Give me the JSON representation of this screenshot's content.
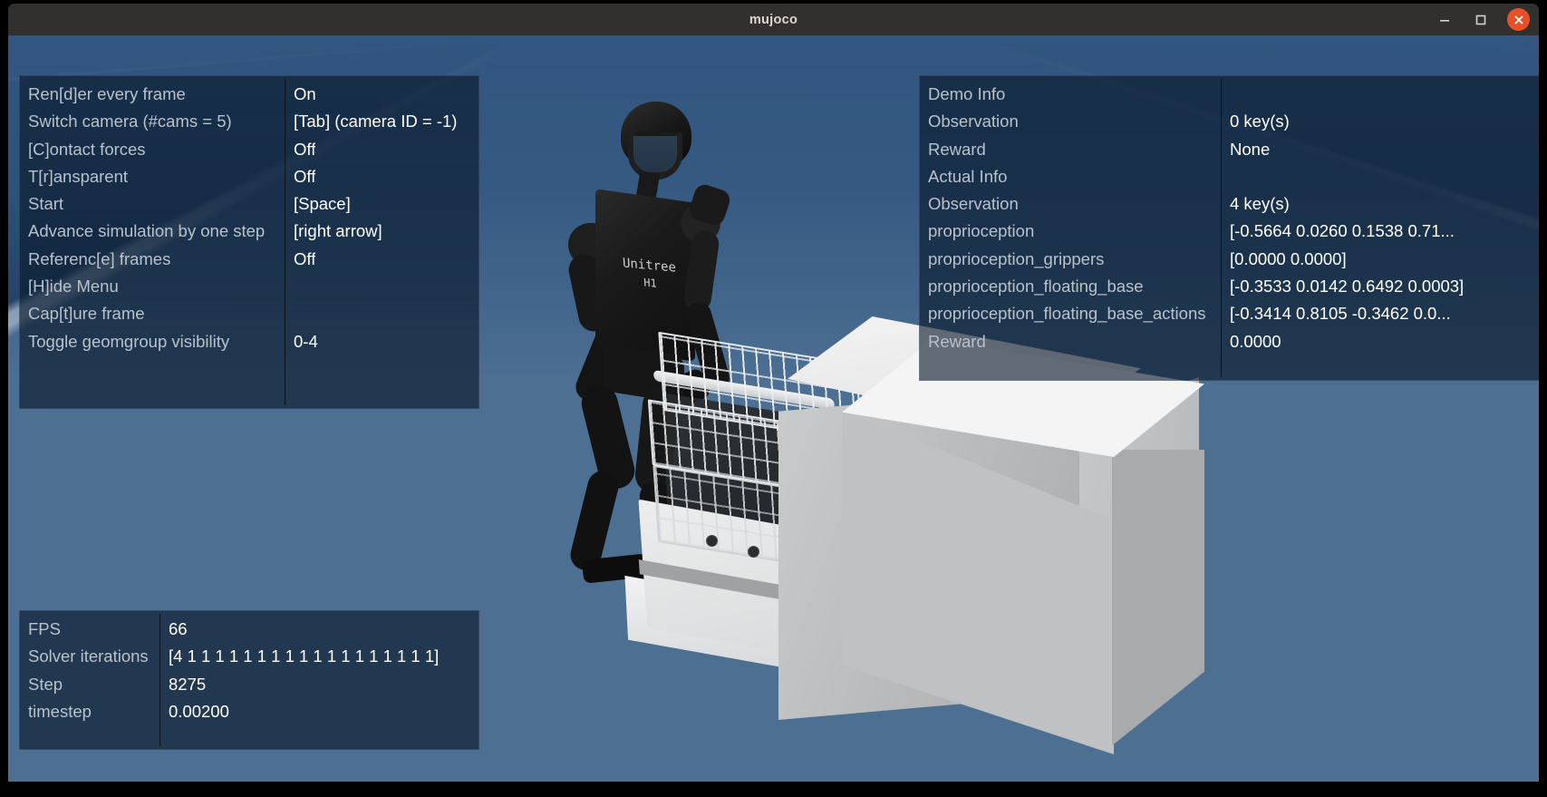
{
  "window": {
    "title": "mujoco",
    "minimize_label": "minimize",
    "maximize_label": "maximize",
    "close_label": "close"
  },
  "help_panel": {
    "rows": [
      {
        "label": "Ren[d]er every frame",
        "value": "On"
      },
      {
        "label": "Switch camera (#cams = 5)",
        "value": "[Tab] (camera ID = -1)"
      },
      {
        "label": "[C]ontact forces",
        "value": "Off"
      },
      {
        "label": "T[r]ansparent",
        "value": "Off"
      },
      {
        "label": "Start",
        "value": "[Space]"
      },
      {
        "label": "Advance simulation by one step",
        "value": "[right arrow]"
      },
      {
        "label": "Referenc[e] frames",
        "value": "Off"
      },
      {
        "label": "[H]ide Menu",
        "value": ""
      },
      {
        "label": "Cap[t]ure frame",
        "value": ""
      },
      {
        "label": "Toggle geomgroup visibility",
        "value": "0-4"
      }
    ]
  },
  "info_panel": {
    "rows": [
      {
        "label": "Demo Info",
        "value": ""
      },
      {
        "label": "Observation",
        "value": "0 key(s)"
      },
      {
        "label": "Reward",
        "value": "None"
      },
      {
        "label": "Actual Info",
        "value": ""
      },
      {
        "label": "Observation",
        "value": "4 key(s)"
      },
      {
        "label": "proprioception",
        "value": "[-0.5664 0.0260 0.1538 0.71..."
      },
      {
        "label": "proprioception_grippers",
        "value": "[0.0000 0.0000]"
      },
      {
        "label": "proprioception_floating_base",
        "value": "[-0.3533 0.0142 0.6492 0.0003]"
      },
      {
        "label": "proprioception_floating_base_actions",
        "value": "[-0.3414 0.8105 -0.3462 0.0..."
      },
      {
        "label": "Reward",
        "value": "0.0000"
      }
    ]
  },
  "stats_panel": {
    "rows": [
      {
        "label": "FPS",
        "value": "66"
      },
      {
        "label": "Solver iterations",
        "value": "[4 1 1 1 1 1 1 1 1 1 1 1 1 1 1 1 1 1 1]"
      },
      {
        "label": "Step",
        "value": "8275"
      },
      {
        "label": "timestep",
        "value": "0.00200"
      }
    ]
  },
  "scene": {
    "robot_brand": "Unitree",
    "robot_model": "H1",
    "floor_color_dark": "#1d3a5c",
    "floor_color_light": "#4c6f92",
    "sky_color": "#32567f",
    "robot_color": "#141414",
    "appliance_color": "#bfc1c3"
  }
}
